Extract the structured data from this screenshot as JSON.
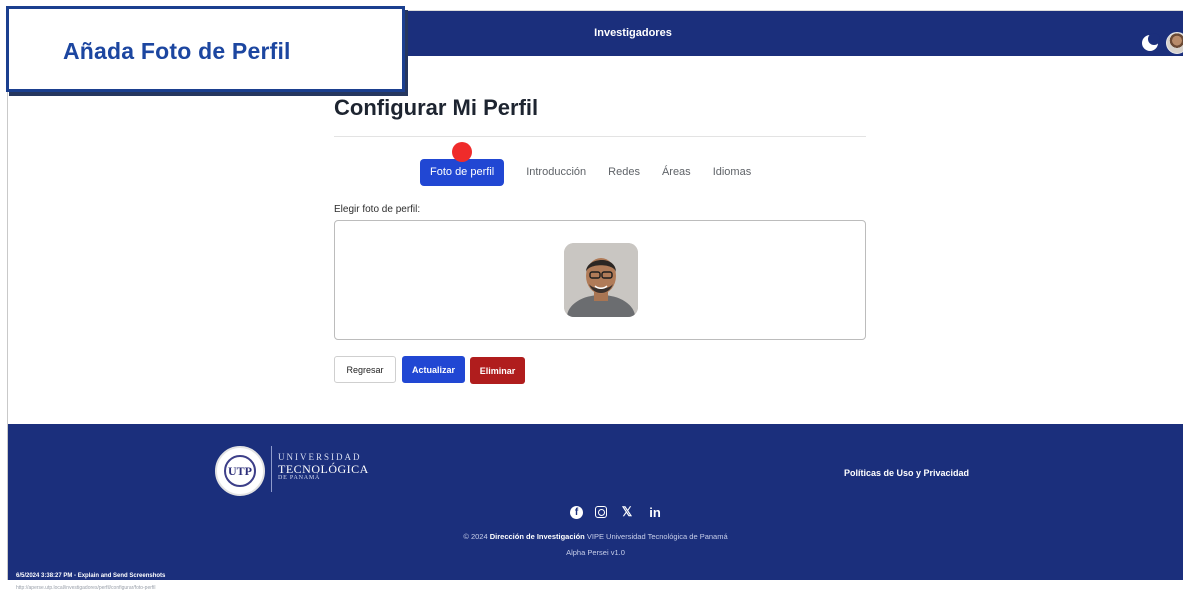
{
  "navbar": {
    "title": "Investigadores",
    "theme_icon": "moon-icon",
    "avatar": "user-avatar"
  },
  "callout": {
    "text": "Añada Foto de Perfil"
  },
  "main": {
    "heading": "Configurar Mi Perfil",
    "tabs": [
      {
        "label": "Foto de perfil",
        "active": true
      },
      {
        "label": "Introducción",
        "active": false
      },
      {
        "label": "Redes",
        "active": false
      },
      {
        "label": "Áreas",
        "active": false
      },
      {
        "label": "Idiomas",
        "active": false
      }
    ],
    "field_label": "Elegir foto de perfil:",
    "buttons": {
      "back": "Regresar",
      "update": "Actualizar",
      "delete": "Eliminar"
    }
  },
  "footer": {
    "logo": {
      "line1": "UNIVERSIDAD",
      "line2": "TECNOLÓGICA",
      "line3": "DE PANAMÁ",
      "seal_text": "UTP"
    },
    "policy_link": "Políticas de Uso y Privacidad",
    "social": [
      "facebook-icon",
      "instagram-icon",
      "x-icon",
      "linkedin-icon"
    ],
    "copyright_prefix": "© 2024",
    "copyright_bold": "Dirección de Investigación",
    "copyright_suffix": "VIPE Universidad Tecnológica de Panamá",
    "version": "Alpha Persei v1.0"
  },
  "status": {
    "line1": "6/5/2024 3:38:27 PM - Explain and Send Screenshots",
    "line2": "http://aperse.utp.local/investigadores/perfil/configurar/foto-perfil"
  },
  "colors": {
    "navy": "#1b2f7c",
    "primary": "#2147d3",
    "danger": "#b01d1d",
    "callout_blue": "#1c46a0",
    "click_marker": "#ef2b2b"
  }
}
